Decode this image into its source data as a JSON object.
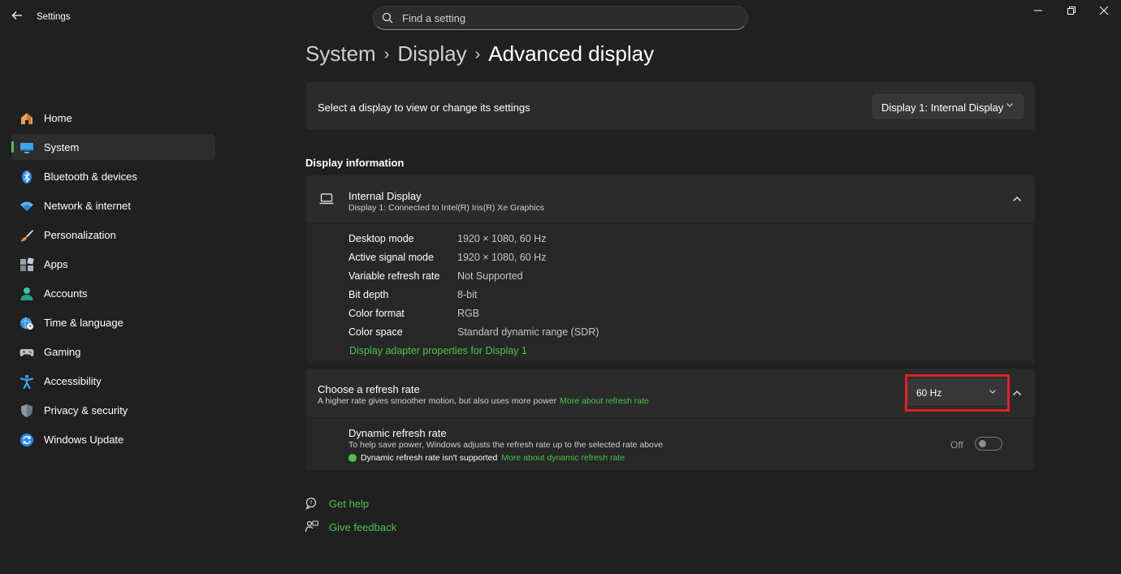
{
  "titlebar": {
    "app_title": "Settings",
    "search_placeholder": "Find a setting"
  },
  "sidebar": {
    "items": [
      {
        "label": "Home",
        "icon": "home-icon",
        "active": false
      },
      {
        "label": "System",
        "icon": "system-display-icon",
        "active": true
      },
      {
        "label": "Bluetooth & devices",
        "icon": "bluetooth-icon",
        "active": false
      },
      {
        "label": "Network & internet",
        "icon": "wifi-icon",
        "active": false
      },
      {
        "label": "Personalization",
        "icon": "brush-icon",
        "active": false
      },
      {
        "label": "Apps",
        "icon": "apps-icon",
        "active": false
      },
      {
        "label": "Accounts",
        "icon": "account-icon",
        "active": false
      },
      {
        "label": "Time & language",
        "icon": "globe-clock-icon",
        "active": false
      },
      {
        "label": "Gaming",
        "icon": "gamepad-icon",
        "active": false
      },
      {
        "label": "Accessibility",
        "icon": "accessibility-icon",
        "active": false
      },
      {
        "label": "Privacy & security",
        "icon": "shield-icon",
        "active": false
      },
      {
        "label": "Windows Update",
        "icon": "update-icon",
        "active": false
      }
    ]
  },
  "breadcrumb": {
    "level1": "System",
    "level2": "Display",
    "current": "Advanced display"
  },
  "select_display": {
    "label": "Select a display to view or change its settings",
    "selected": "Display 1: Internal Display"
  },
  "display_info": {
    "section_title": "Display information",
    "name": "Internal Display",
    "connection": "Display 1: Connected to Intel(R) Iris(R) Xe Graphics",
    "rows": [
      {
        "key": "Desktop mode",
        "value": "1920 × 1080, 60 Hz"
      },
      {
        "key": "Active signal mode",
        "value": "1920 × 1080, 60 Hz"
      },
      {
        "key": "Variable refresh rate",
        "value": "Not Supported"
      },
      {
        "key": "Bit depth",
        "value": "8-bit"
      },
      {
        "key": "Color format",
        "value": "RGB"
      },
      {
        "key": "Color space",
        "value": "Standard dynamic range (SDR)"
      }
    ],
    "adapter_link": "Display adapter properties for Display 1"
  },
  "refresh_rate": {
    "title": "Choose a refresh rate",
    "description": "A higher rate gives smoother motion, but also uses more power",
    "more_link": "More about refresh rate",
    "selected": "60 Hz"
  },
  "dynamic_refresh": {
    "title": "Dynamic refresh rate",
    "description": "To help save power, Windows adjusts the refresh rate up to the selected rate above",
    "status": "Dynamic refresh rate isn't supported",
    "more_link": "More about dynamic refresh rate",
    "toggle_label": "Off",
    "toggle_on": false
  },
  "footer": {
    "help": "Get help",
    "feedback": "Give feedback"
  },
  "colors": {
    "background": "#202020",
    "card": "#2b2b2b",
    "accent_green": "#4cc24c",
    "highlight_red": "#e0202a"
  }
}
